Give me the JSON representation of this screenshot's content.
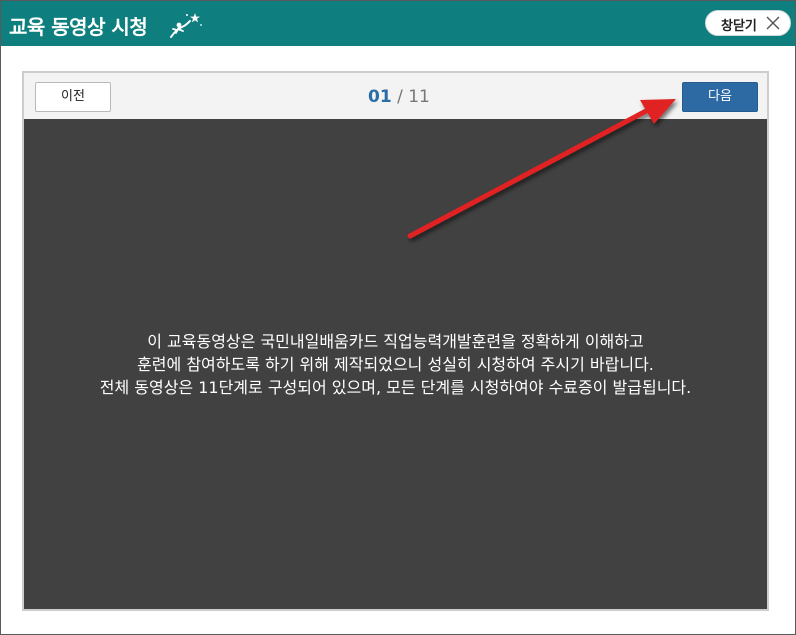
{
  "window": {
    "title": "교육 동영상 시청",
    "close_label": "창닫기",
    "title_color": "#0f7e7e"
  },
  "icons": {
    "title_decoration": "star-figure-icon",
    "close": "close-icon",
    "annotation": "red-arrow-annotation"
  },
  "navigation": {
    "prev_label": "이전",
    "next_label": "다음",
    "current_page": "01",
    "separator": "/",
    "total_pages": "11"
  },
  "content": {
    "notice_lines": [
      "이 교육동영상은 국민내일배움카드 직업능력개발훈련을 정확하게 이해하고",
      "훈련에 참여하도록 하기 위해 제작되었으니 성실히 시청하여 주시기 바랍니다.",
      "전체 동영상은 11단계로 구성되어 있으며, 모든 단계를 시청하여야 수료증이 발급됩니다."
    ]
  },
  "colors": {
    "accent": "#0f7e7e",
    "next_button": "#2d6aa3",
    "video_background": "#414141",
    "arrow": "#e02020"
  }
}
